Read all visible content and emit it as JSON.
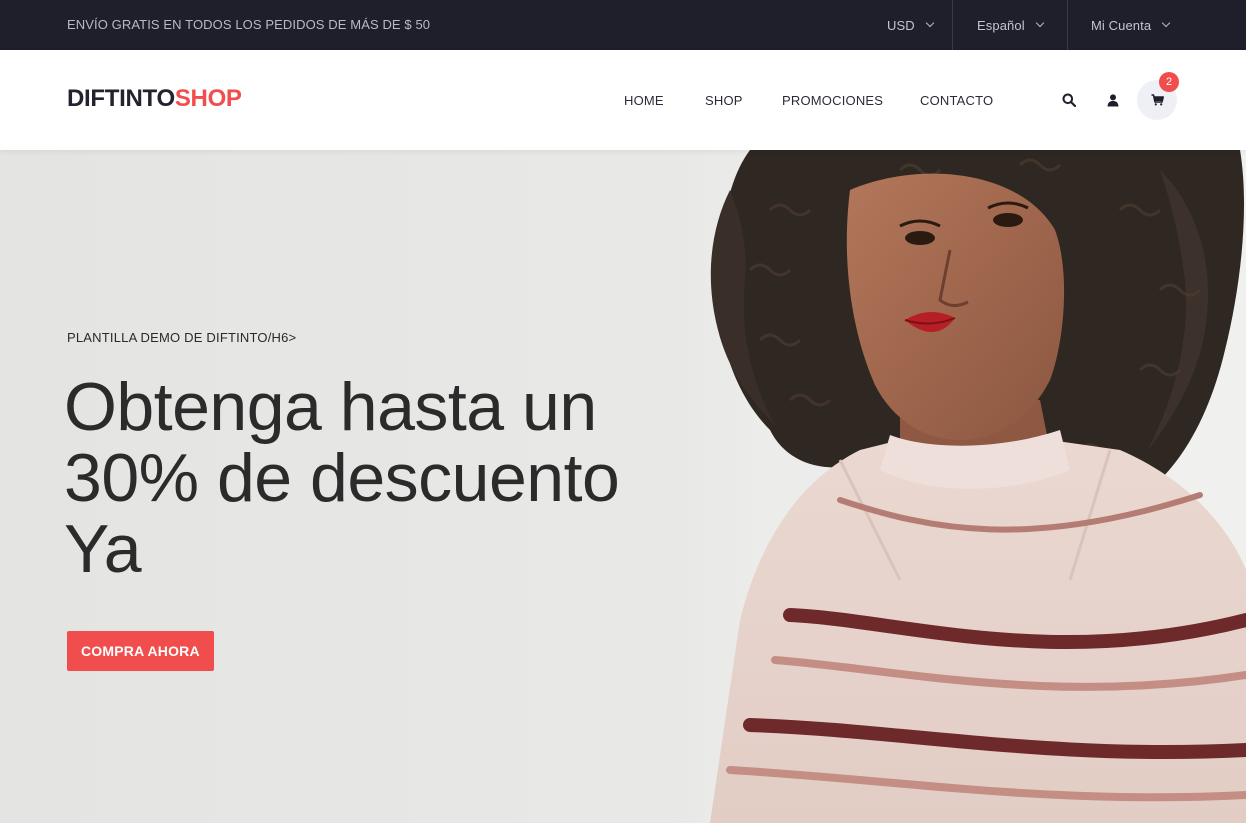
{
  "topbar": {
    "promo": "ENVÍO GRATIS EN TODOS LOS PEDIDOS DE MÁS DE $ 50",
    "currency": "USD",
    "language": "Español",
    "account": "Mi Cuenta"
  },
  "header": {
    "logo_main": "DIFTINTO",
    "logo_accent": "SHOP",
    "nav": [
      "HOME",
      "SHOP",
      "PROMOCIONES",
      "CONTACTO"
    ],
    "cart_count": "2"
  },
  "hero": {
    "pretitle": "PLANTILLA DEMO DE DIFTINTO/H6>",
    "headline_line1": "Obtenga hasta un",
    "headline_line2": "30% de descuento",
    "headline_line3": "Ya",
    "cta": "COMPRA AHORA"
  },
  "colors": {
    "accent": "#f24d4d",
    "topbar_bg": "#1f1f2b",
    "hero_bg": "#e6e6e4"
  },
  "icons": [
    "chevron-down-icon",
    "search-icon",
    "user-icon",
    "cart-icon"
  ]
}
